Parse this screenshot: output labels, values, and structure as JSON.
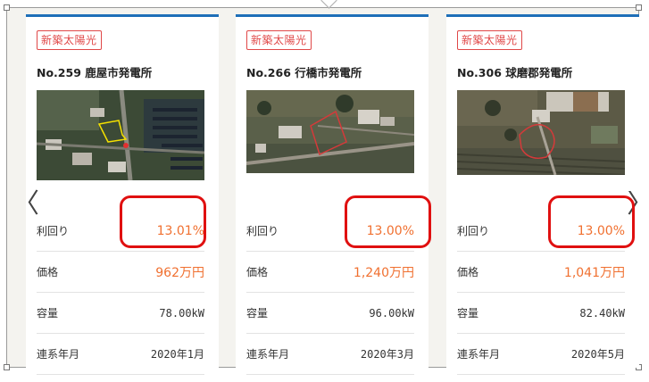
{
  "cards": [
    {
      "badge": "新築太陽光",
      "title": "No.259 鹿屋市発電所",
      "rows": [
        {
          "label": "利回り",
          "value": "13.01%"
        },
        {
          "label": "価格",
          "value": "962万円"
        },
        {
          "label": "容量",
          "value": "78.00kW"
        },
        {
          "label": "連系年月",
          "value": "2020年1月"
        }
      ]
    },
    {
      "badge": "新築太陽光",
      "title": "No.266 行橋市発電所",
      "rows": [
        {
          "label": "利回り",
          "value": "13.00%"
        },
        {
          "label": "価格",
          "value": "1,240万円"
        },
        {
          "label": "容量",
          "value": "96.00kW"
        },
        {
          "label": "連系年月",
          "value": "2020年3月"
        }
      ]
    },
    {
      "badge": "新築太陽光",
      "title": "No.306 球磨郡発電所",
      "rows": [
        {
          "label": "利回り",
          "value": "13.00%"
        },
        {
          "label": "価格",
          "value": "1,041万円"
        },
        {
          "label": "容量",
          "value": "82.40kW"
        },
        {
          "label": "連系年月",
          "value": "2020年5月"
        }
      ]
    }
  ],
  "nav": {
    "prev": "〈",
    "next": "〉"
  },
  "colors": {
    "accent": "#f07030",
    "badge": "#e04848",
    "topbar": "#1e6fb8",
    "annotation": "#e01010"
  }
}
